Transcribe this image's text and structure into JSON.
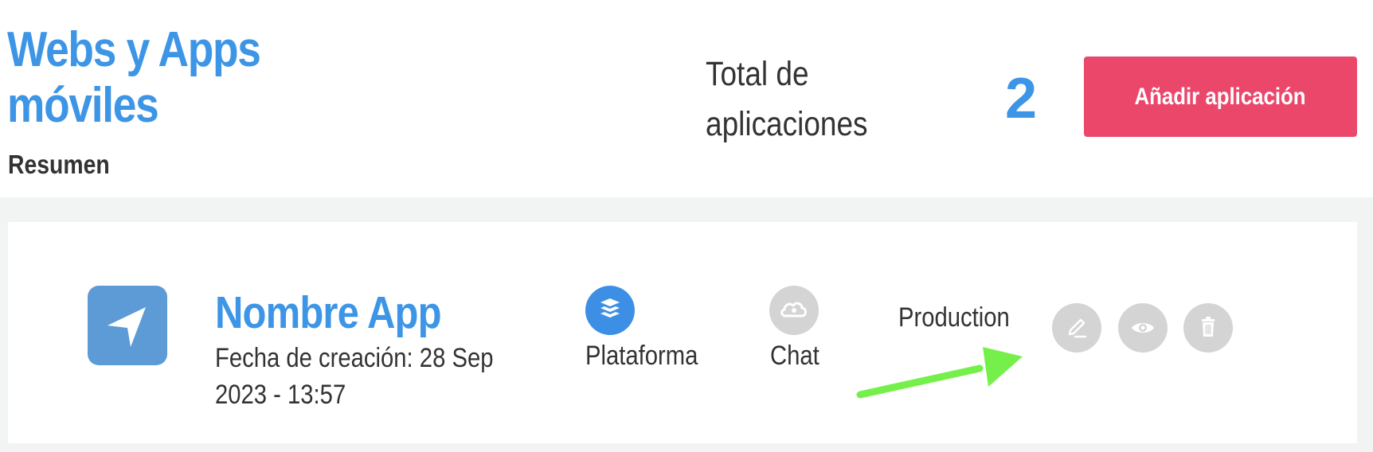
{
  "header": {
    "title": "Webs y Apps móviles",
    "subtitle": "Resumen"
  },
  "summary": {
    "total_label": "Total de aplicaciones",
    "total_count": "2",
    "add_button_label": "Añadir aplicación"
  },
  "app": {
    "name": "Nombre App",
    "created": "Fecha de creación: 28 Sep 2023 - 13:57",
    "features": [
      {
        "label": "Plataforma",
        "icon": "layers-icon",
        "color": "#3d8fe6",
        "active": true
      },
      {
        "label": "Chat",
        "icon": "cloud-chat-icon",
        "color": "#d4d4d4",
        "active": false
      }
    ],
    "status": "Production",
    "actions": [
      {
        "icon": "edit-icon"
      },
      {
        "icon": "eye-icon"
      },
      {
        "icon": "trash-icon"
      }
    ]
  },
  "colors": {
    "accent": "#3d95e6",
    "primary_button": "#eb476b",
    "app_icon": "#5c9bd6",
    "inactive_icon": "#d4d4d4",
    "annotation_arrow": "#75f04b"
  }
}
